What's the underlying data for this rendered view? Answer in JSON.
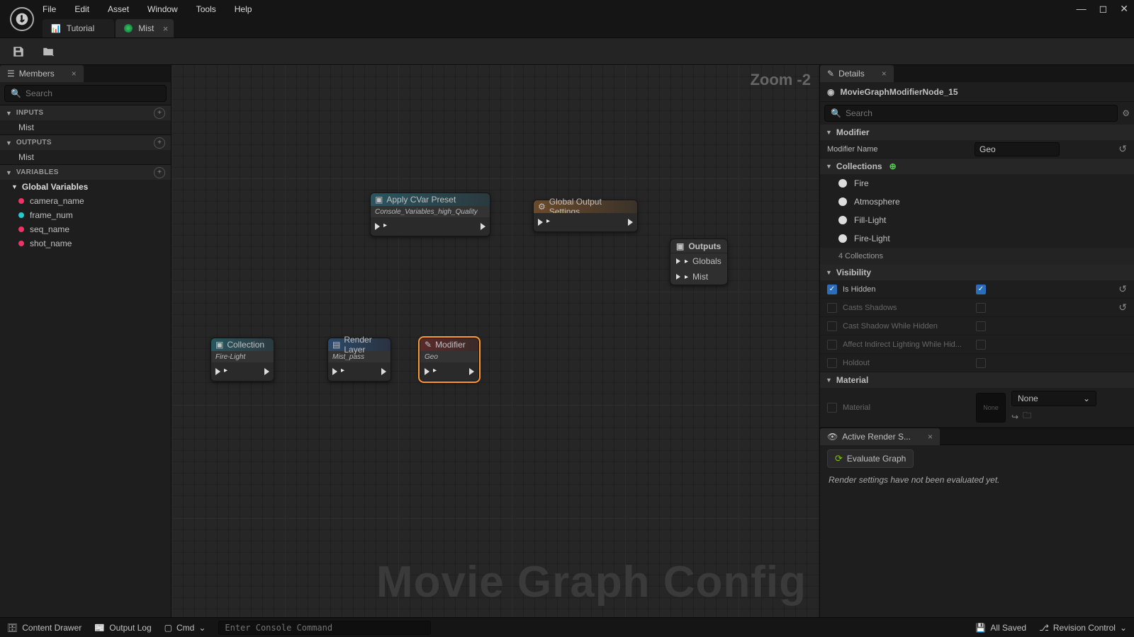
{
  "menu": {
    "file": "File",
    "edit": "Edit",
    "asset": "Asset",
    "window": "Window",
    "tools": "Tools",
    "help": "Help"
  },
  "tabs": {
    "tutorial": "Tutorial",
    "mist": "Mist"
  },
  "left": {
    "panel_title": "Members",
    "search_placeholder": "Search",
    "inputs": "INPUTS",
    "outputs": "OUTPUTS",
    "variables": "VARIABLES",
    "mist": "Mist",
    "global_vars": "Global Variables",
    "vars": [
      "camera_name",
      "frame_num",
      "seq_name",
      "shot_name"
    ]
  },
  "graph": {
    "zoom": "Zoom -2",
    "watermark": "Movie Graph Config",
    "apply_cvar": {
      "title": "Apply CVar Preset",
      "sub": "Console_Variables_high_Quality"
    },
    "global_out": {
      "title": "Global Output Settings"
    },
    "collection": {
      "title": "Collection",
      "sub": "Fire-Light"
    },
    "render_layer": {
      "title": "Render Layer",
      "sub": "Mist_pass"
    },
    "modifier": {
      "title": "Modifier",
      "sub": "Geo"
    },
    "outputs": {
      "title": "Outputs",
      "globals": "Globals",
      "mist": "Mist"
    }
  },
  "details": {
    "panel_title": "Details",
    "object": "MovieGraphModifierNode_15",
    "search_placeholder": "Search",
    "sect_modifier": "Modifier",
    "modifier_name_lbl": "Modifier Name",
    "modifier_name_val": "Geo",
    "sect_collections": "Collections",
    "collections": [
      "Fire",
      "Atmosphere",
      "Fill-Light",
      "Fire-Light"
    ],
    "coll_count": "4 Collections",
    "sect_visibility": "Visibility",
    "is_hidden": "Is Hidden",
    "casts_shadows": "Casts Shadows",
    "cast_hidden": "Cast Shadow While Hidden",
    "affect_indirect": "Affect Indirect Lighting While Hid...",
    "holdout": "Holdout",
    "sect_material": "Material",
    "material_lbl": "Material",
    "material_val": "None",
    "thumb": "None"
  },
  "render": {
    "panel_title": "Active Render S...",
    "evaluate": "Evaluate Graph",
    "msg": "Render settings have not been evaluated yet."
  },
  "status": {
    "content_drawer": "Content Drawer",
    "output_log": "Output Log",
    "cmd": "Cmd",
    "cmd_placeholder": "Enter Console Command",
    "all_saved": "All Saved",
    "revision": "Revision Control"
  }
}
